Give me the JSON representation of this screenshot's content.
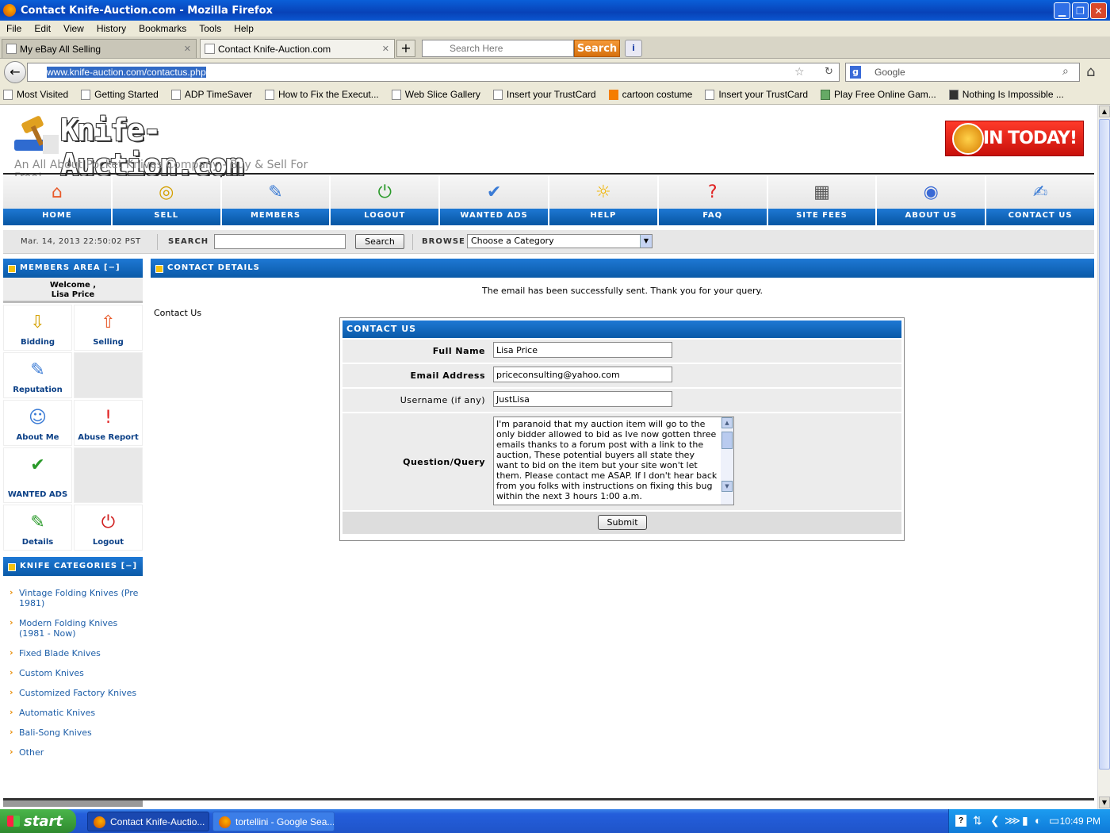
{
  "window": {
    "title": "Contact Knife-Auction.com - Mozilla Firefox"
  },
  "menu": [
    "File",
    "Edit",
    "View",
    "History",
    "Bookmarks",
    "Tools",
    "Help"
  ],
  "tabs": [
    {
      "label": "My eBay All Selling"
    },
    {
      "label": "Contact Knife-Auction.com"
    }
  ],
  "toolbar_search": {
    "placeholder": "Search Here",
    "button": "Search"
  },
  "address": {
    "url": "www.knife-auction.com/contactus.php",
    "search_engine_placeholder": "Google"
  },
  "bookmarks": [
    "Most Visited",
    "Getting Started",
    "ADP TimeSaver",
    "How to Fix the Execut...",
    "Web Slice Gallery",
    "Insert your TrustCard",
    "cartoon costume",
    "Insert your TrustCard",
    "Play Free Online Gam...",
    "Nothing Is Impossible ..."
  ],
  "site": {
    "logo_text": "Knife-Auction.com",
    "tagline": "An All About Pocket Knives Company - Buy & Sell For Free!",
    "join_label": "JOIN TODAY!"
  },
  "nav": [
    {
      "label": "HOME",
      "icon": "house-icon",
      "glyph": "⌂",
      "color": "#e85a2a"
    },
    {
      "label": "SELL",
      "icon": "coins-icon",
      "glyph": "◎",
      "color": "#d4a000"
    },
    {
      "label": "MEMBERS",
      "icon": "members-icon",
      "glyph": "✎",
      "color": "#3a7bd5"
    },
    {
      "label": "LOGOUT",
      "icon": "power-icon",
      "glyph": "⏻",
      "color": "#2a9a2a"
    },
    {
      "label": "WANTED ADS",
      "icon": "wanted-icon",
      "glyph": "✔",
      "color": "#3a7bd5"
    },
    {
      "label": "HELP",
      "icon": "lightbulb-icon",
      "glyph": "☼",
      "color": "#f0b400"
    },
    {
      "label": "FAQ",
      "icon": "question-icon",
      "glyph": "?",
      "color": "#e02020"
    },
    {
      "label": "SITE FEES",
      "icon": "calculator-icon",
      "glyph": "▦",
      "color": "#555555"
    },
    {
      "label": "ABOUT US",
      "icon": "globe-icon",
      "glyph": "◉",
      "color": "#3a6ad5"
    },
    {
      "label": "CONTACT US",
      "icon": "notepad-icon",
      "glyph": "✍",
      "color": "#3a7bd5"
    }
  ],
  "strip": {
    "datetime": "Mar. 14, 2013 22:50:02  PST",
    "search_label": "SEARCH",
    "search_button": "Search",
    "browse_label": "BROWSE",
    "category_selected": "Choose a Category"
  },
  "members_area": {
    "title": "MEMBERS AREA [−]",
    "welcome": "Welcome ,",
    "username": "Lisa Price",
    "items": [
      {
        "label": "Bidding",
        "icon": "bidding-icon",
        "glyph": "⇩"
      },
      {
        "label": "Selling",
        "icon": "selling-icon",
        "glyph": "⇧"
      },
      {
        "label": "Reputation",
        "icon": "reputation-icon",
        "glyph": "✎"
      },
      {
        "label": "About Me",
        "icon": "about-me-icon",
        "glyph": "☺"
      },
      {
        "label": "Abuse Report",
        "icon": "abuse-report-icon",
        "glyph": "!"
      },
      {
        "label": "WANTED ADS",
        "icon": "wanted-ads-icon",
        "glyph": "✔"
      },
      {
        "label": "Details",
        "icon": "details-icon",
        "glyph": "✎"
      },
      {
        "label": "Logout",
        "icon": "logout-icon",
        "glyph": "⏻"
      }
    ]
  },
  "categories": {
    "title": "KNIFE CATEGORIES [−]",
    "items": [
      "Vintage Folding Knives (Pre 1981)",
      "Modern Folding Knives (1981 - Now)",
      "Fixed Blade Knives",
      "Custom Knives",
      "Customized Factory Knives",
      "Automatic Knives",
      "Bali-Song Knives",
      "Other"
    ]
  },
  "main": {
    "title": "CONTACT DETAILS",
    "success": "The email has been successfully sent. Thank you for your query.",
    "contact_label": "Contact Us",
    "form": {
      "title": "CONTACT US",
      "full_name_label": "Full Name",
      "full_name": "Lisa Price",
      "email_label": "Email Address",
      "email": "priceconsulting@yahoo.com",
      "username_label": "Username (if any)",
      "username": "JustLisa",
      "query_label": "Question/Query",
      "query": "I'm paranoid that my auction item will go to the only bidder allowed to bid as Ive now gotten three emails thanks to a forum post with a link to the auction, These potential buyers all state they want to bid on the item but your site won't let them. Please contact me ASAP. If I don't hear back from you folks with instructions on fixing this bug within the next 3 hours 1:00 a.m.",
      "submit": "Submit"
    }
  },
  "taskbar": {
    "start": "start",
    "tasks": [
      "Contact Knife-Auctio...",
      "tortellini - Google Sea..."
    ],
    "clock": "10:49 PM"
  }
}
